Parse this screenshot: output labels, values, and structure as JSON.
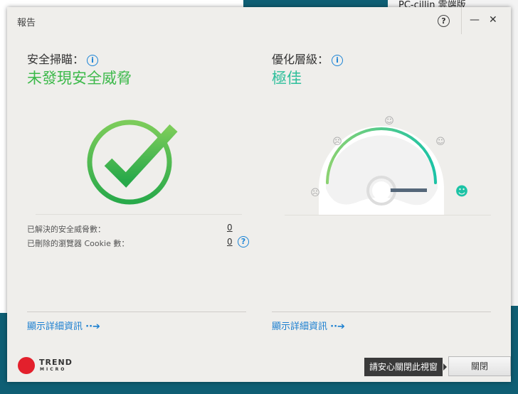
{
  "background": {
    "app_title": "PC-cillin 雲端版"
  },
  "dialog": {
    "title": "報告",
    "help_icon": "?",
    "minimize_icon": "—",
    "close_icon": "✕",
    "security": {
      "label": "安全掃瞄：",
      "status": "未發現安全威脅",
      "status_color": "#3cb94a",
      "rows": [
        {
          "label": "已解決的安全威脅數：",
          "value": "0"
        },
        {
          "label": "已刪除的瀏覽器 Cookie 數：",
          "value": "0"
        }
      ],
      "details_link": "顯示詳細資訊"
    },
    "optimization": {
      "label": "優化層級：",
      "status": "極佳",
      "status_color": "#2dbf9b",
      "gauge_level": "5 of 5",
      "details_link": "顯示詳細資訊"
    },
    "tooltip": "請安心關閉此視窗",
    "close_button": "關閉",
    "logo": {
      "line1": "TREND",
      "line2": "MICRO"
    }
  }
}
